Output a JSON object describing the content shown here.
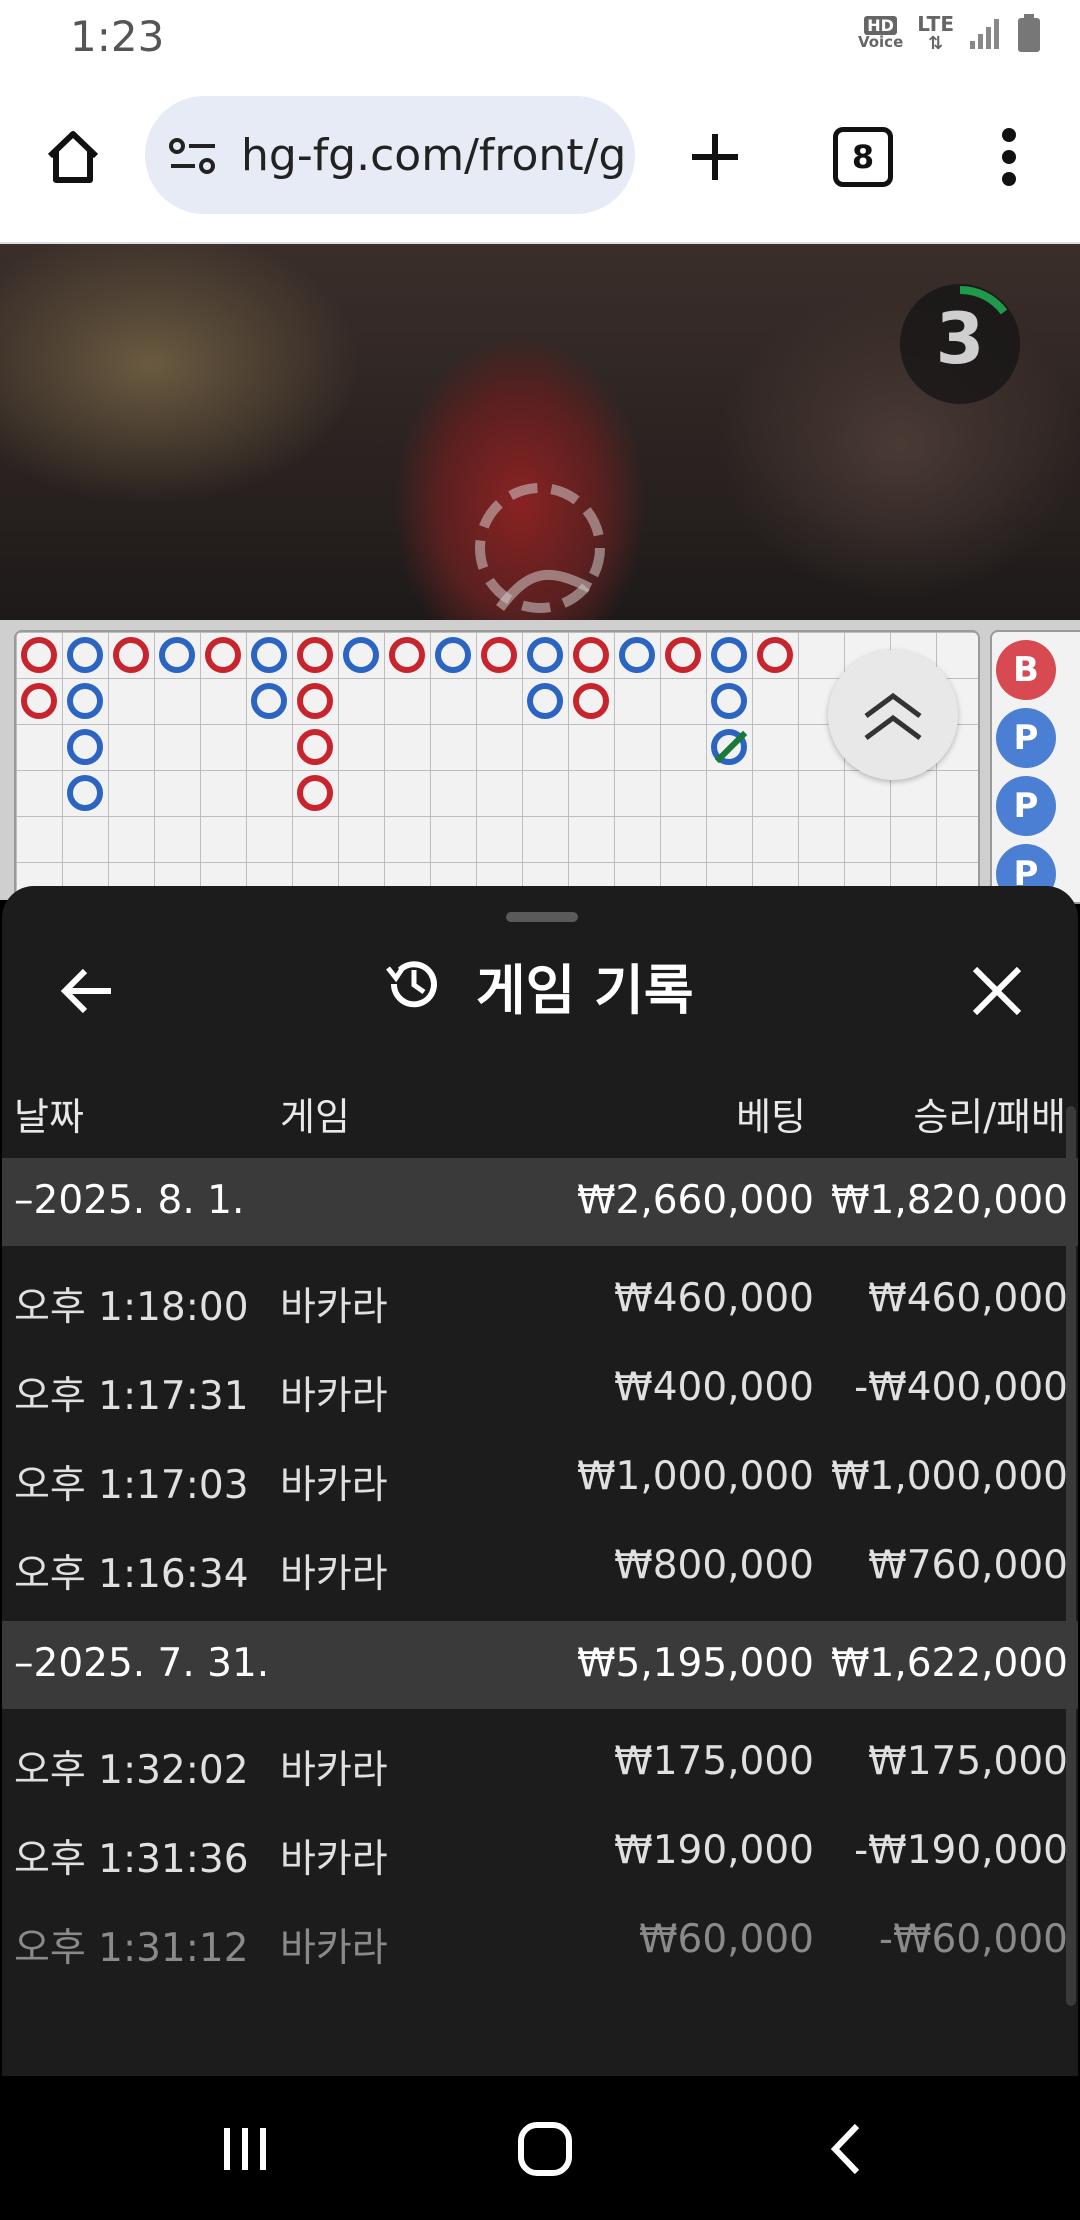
{
  "status": {
    "time": "1:23",
    "hd_label": "HD",
    "voice_label": "Voice",
    "lte_label": "LTE"
  },
  "browser": {
    "url": "hg-fg.com/front/g",
    "tab_count": "8"
  },
  "video": {
    "countdown": "3"
  },
  "road": {
    "beads": [
      "B",
      "P",
      "P",
      "P"
    ],
    "colors": {
      "banker": "#c8242d",
      "player": "#2b64c1",
      "tie": "#1a7a3a"
    }
  },
  "sheet": {
    "title": "게임 기록",
    "columns": {
      "date": "날짜",
      "game": "게임",
      "bet": "베팅",
      "winloss": "승리/패배"
    },
    "groups": [
      {
        "date": "–2025. 8. 1.",
        "bet_total": "₩2,660,000",
        "winloss_total": "₩1,820,000",
        "rows": [
          {
            "time": "오후 1:18:00",
            "game": "바카라",
            "bet": "₩460,000",
            "winloss": "₩460,000"
          },
          {
            "time": "오후 1:17:31",
            "game": "바카라",
            "bet": "₩400,000",
            "winloss": "-₩400,000"
          },
          {
            "time": "오후 1:17:03",
            "game": "바카라",
            "bet": "₩1,000,000",
            "winloss": "₩1,000,000"
          },
          {
            "time": "오후 1:16:34",
            "game": "바카라",
            "bet": "₩800,000",
            "winloss": "₩760,000"
          }
        ]
      },
      {
        "date": "–2025. 7. 31.",
        "bet_total": "₩5,195,000",
        "winloss_total": "₩1,622,000",
        "rows": [
          {
            "time": "오후 1:32:02",
            "game": "바카라",
            "bet": "₩175,000",
            "winloss": "₩175,000"
          },
          {
            "time": "오후 1:31:36",
            "game": "바카라",
            "bet": "₩190,000",
            "winloss": "-₩190,000"
          },
          {
            "time": "오후 1:31:12",
            "game": "바카라",
            "bet": "₩60,000",
            "winloss": "-₩60,000"
          }
        ]
      }
    ]
  }
}
